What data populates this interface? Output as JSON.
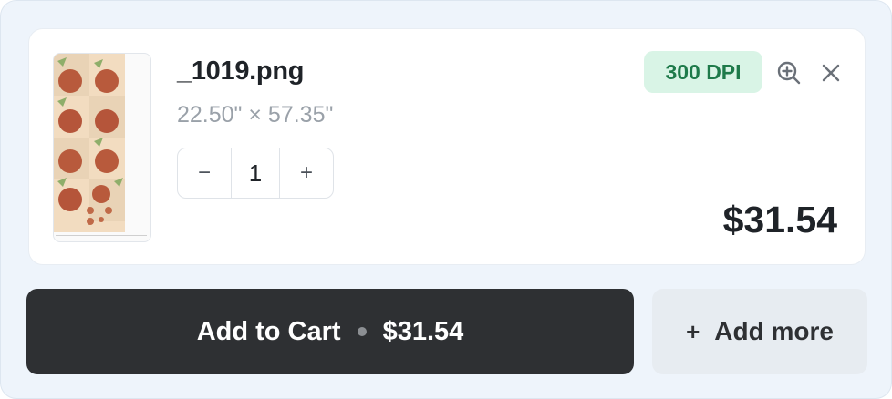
{
  "item": {
    "filename": "_1019.png",
    "dimensions": "22.50\" × 57.35\"",
    "quantity": "1",
    "decrement_label": "−",
    "increment_label": "+",
    "dpi_badge": "300 DPI",
    "price": "$31.54"
  },
  "actions": {
    "add_to_cart_label": "Add to Cart",
    "add_to_cart_price": "$31.54",
    "add_more_icon": "+",
    "add_more_label": "Add more"
  },
  "icons": {
    "zoom": "zoom-in-icon",
    "close": "close-icon"
  },
  "colors": {
    "cart_button": "#2e3033",
    "dpi_badge_bg": "#d9f4e6",
    "dpi_badge_text": "#1e7a4a",
    "panel_bg": "#eef4fb"
  }
}
